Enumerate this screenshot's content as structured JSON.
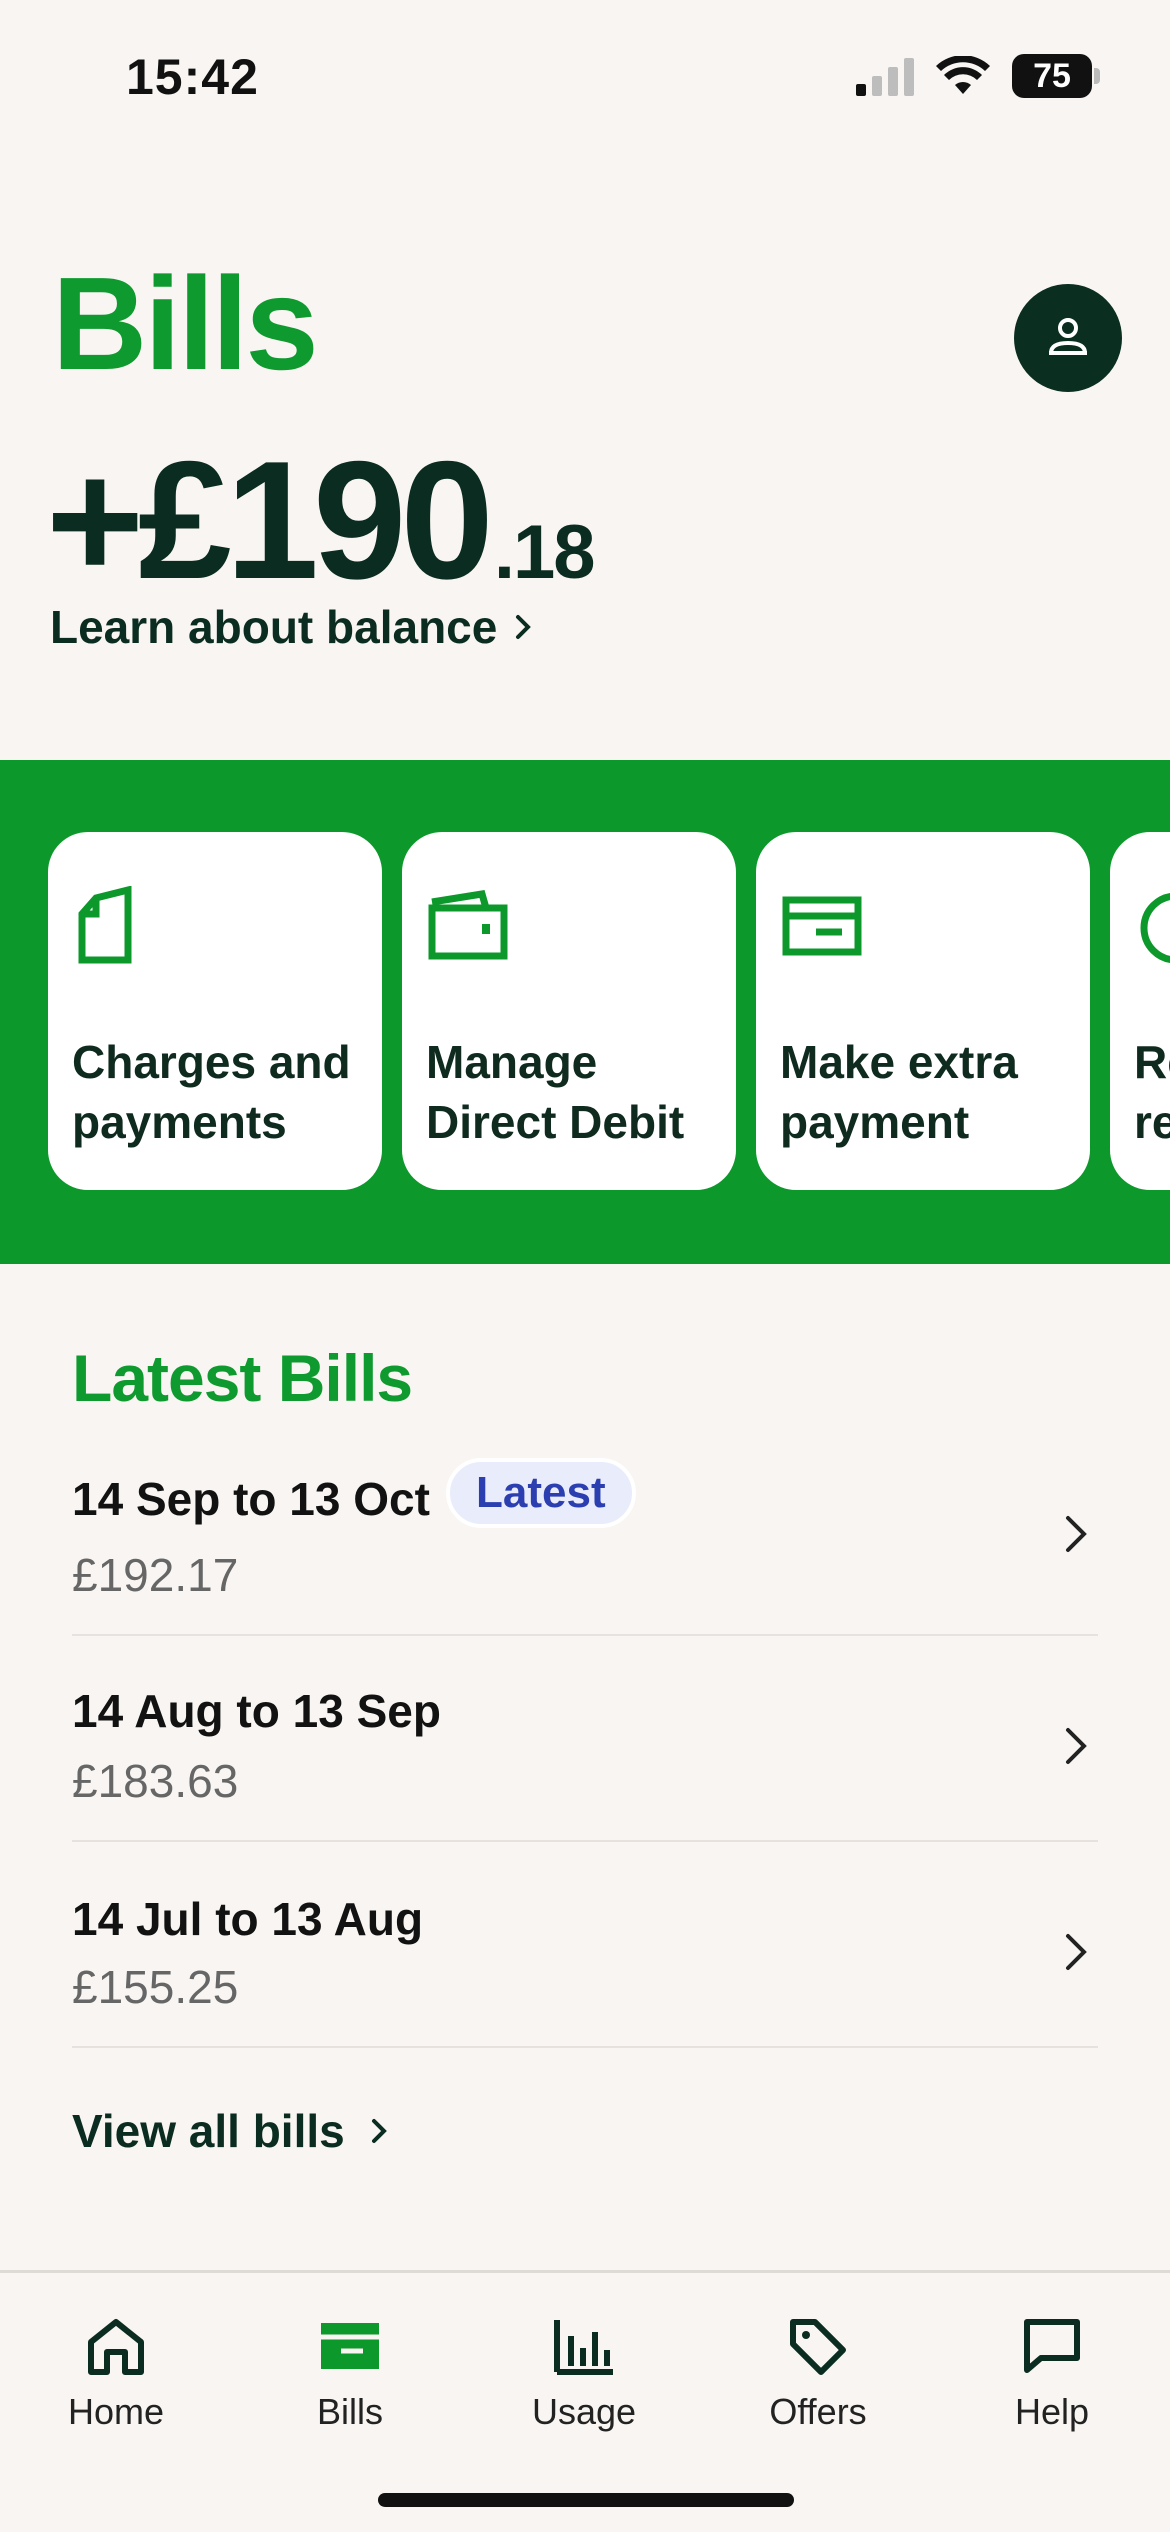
{
  "status_bar": {
    "time": "15:42",
    "battery": "75"
  },
  "header": {
    "title": "Bills",
    "balance_main": "+£190",
    "balance_decimal": ".18",
    "learn_link": "Learn about balance",
    "profile_icon": "person-icon"
  },
  "actions": [
    {
      "label": "Charges and\npayments",
      "icon": "document-icon"
    },
    {
      "label": "Manage\nDirect Debit",
      "icon": "wallet-icon"
    },
    {
      "label": "Make extra\npayment",
      "icon": "card-icon"
    },
    {
      "label": "Re\nre",
      "icon": "clock-icon"
    }
  ],
  "latest_bills": {
    "title": "Latest Bills",
    "items": [
      {
        "period": "14 Sep to 13 Oct",
        "amount": "£192.17",
        "badge": "Latest"
      },
      {
        "period": "14 Aug to 13 Sep",
        "amount": "£183.63"
      },
      {
        "period": "14 Jul to 13 Aug",
        "amount": "£155.25"
      }
    ],
    "view_all": "View all bills"
  },
  "tabs": [
    {
      "label": "Home",
      "icon": "home-icon"
    },
    {
      "label": "Bills",
      "icon": "bills-icon",
      "active": true
    },
    {
      "label": "Usage",
      "icon": "usage-icon"
    },
    {
      "label": "Offers",
      "icon": "tag-icon"
    },
    {
      "label": "Help",
      "icon": "chat-icon"
    }
  ],
  "colors": {
    "brand_green": "#0e9a2e",
    "dark": "#0b2c20",
    "badge_blue": "#2b3fb0"
  }
}
